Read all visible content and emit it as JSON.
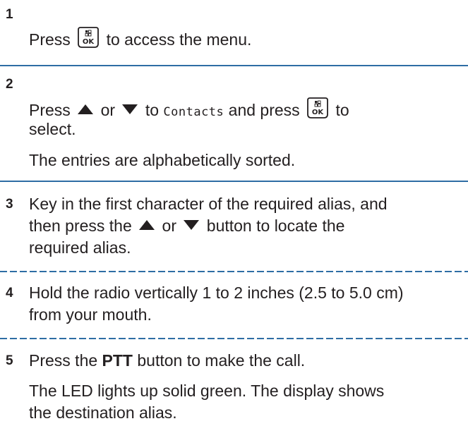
{
  "steps": [
    {
      "number": "1",
      "line1_pre": "Press",
      "line1_post": "to access the menu.",
      "icons": [
        "menu-ok-key-icon"
      ]
    },
    {
      "number": "2",
      "line1_pre": "Press",
      "line1_or": "or",
      "line1_to": "to",
      "menu_item": "Contacts",
      "line1_and": "and press",
      "line1_end": "to",
      "line2": "select.",
      "note": "The entries are alphabetically sorted.",
      "icons": [
        "up-arrow-icon",
        "down-arrow-icon",
        "menu-ok-key-icon"
      ]
    },
    {
      "number": "3",
      "line1": "Key in the first character of the required alias, and",
      "line2_pre": "then press the",
      "line2_or": "or",
      "line2_post": "button to locate the",
      "line3": "required alias.",
      "icons": [
        "up-arrow-icon",
        "down-arrow-icon"
      ]
    },
    {
      "number": "4",
      "line1": "Hold the radio vertically 1 to 2 inches (2.5 to 5.0 cm)",
      "line2": "from your mouth."
    },
    {
      "number": "5",
      "line1_pre": "Press the",
      "line1_bold": "PTT",
      "line1_post": "button to make the call.",
      "note1": "The LED lights up solid green. The display shows",
      "note2": "the destination alias."
    }
  ],
  "colors": {
    "text": "#231f20",
    "rule": "#2e6da4"
  }
}
